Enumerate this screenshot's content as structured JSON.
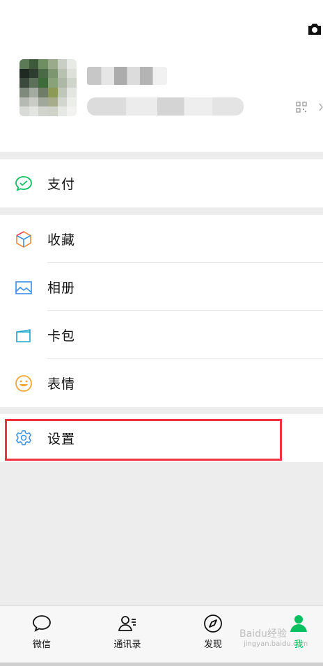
{
  "menu": {
    "pay": {
      "label": "支付",
      "icon": "pay-icon"
    },
    "group2": [
      {
        "label": "收藏",
        "icon": "favorites-icon"
      },
      {
        "label": "相册",
        "icon": "album-icon"
      },
      {
        "label": "卡包",
        "icon": "card-wallet-icon"
      },
      {
        "label": "表情",
        "icon": "sticker-icon"
      }
    ],
    "settings": {
      "label": "设置",
      "icon": "settings-icon"
    }
  },
  "tabs": [
    {
      "label": "微信",
      "icon": "chat-icon"
    },
    {
      "label": "通讯录",
      "icon": "contacts-icon"
    },
    {
      "label": "发现",
      "icon": "discover-icon"
    },
    {
      "label": "我",
      "icon": "me-icon",
      "active": true
    }
  ],
  "watermark": {
    "text": "Baidu经验",
    "sub": "jingyan.baidu.com"
  },
  "colors": {
    "accent": "#07c160",
    "highlight": "#ef3340",
    "background": "#ededed"
  }
}
